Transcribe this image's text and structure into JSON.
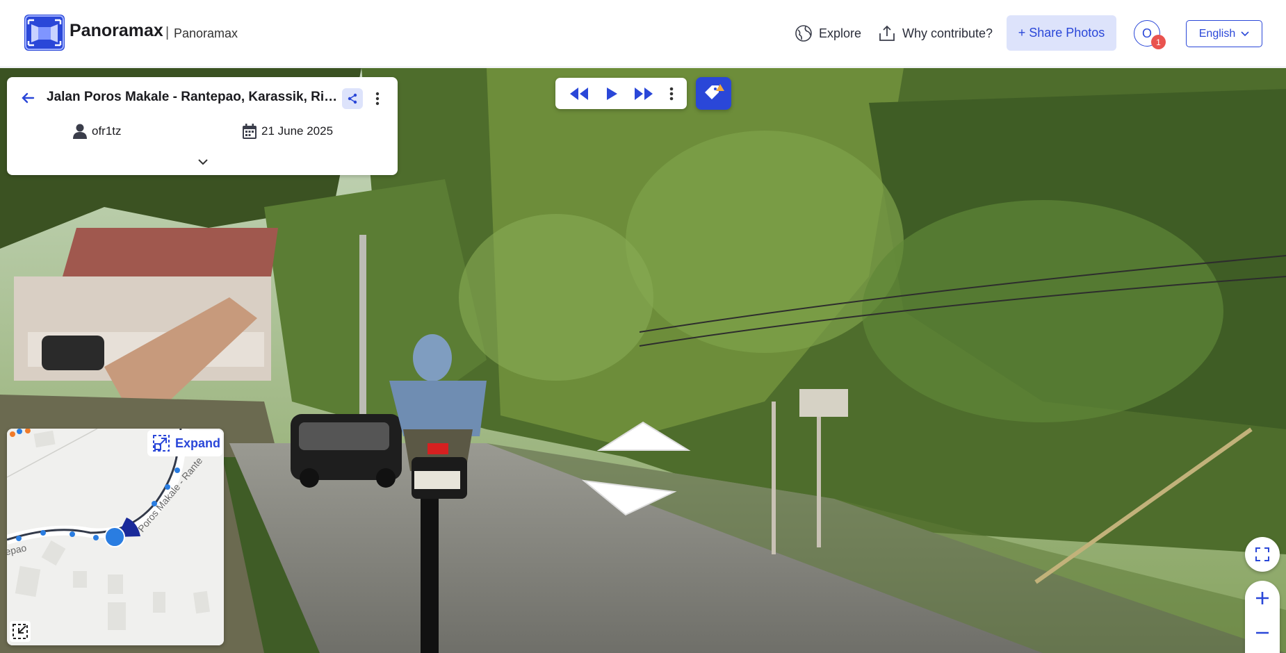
{
  "header": {
    "brand": "Panoramax",
    "separator": "|",
    "subtitle": "Panoramax",
    "nav": [
      {
        "label": "Explore",
        "icon": "globe-icon"
      },
      {
        "label": "Why contribute?",
        "icon": "upload-icon"
      }
    ],
    "share_button": "+ Share Photos",
    "avatar_letter": "O",
    "notification_count": "1",
    "language": "English"
  },
  "photo_card": {
    "title": "Jalan Poros Makale - Rantepao, Karassik, Rin...",
    "author": "ofr1tz",
    "date": "21 June 2025"
  },
  "minimap": {
    "expand_label": "Expand",
    "road_label": "Poros Makale - Rante",
    "road_label_left": "epao"
  },
  "colors": {
    "accent": "#2a47d8",
    "accent_light": "#dde3fb",
    "badge": "#e9534f"
  }
}
